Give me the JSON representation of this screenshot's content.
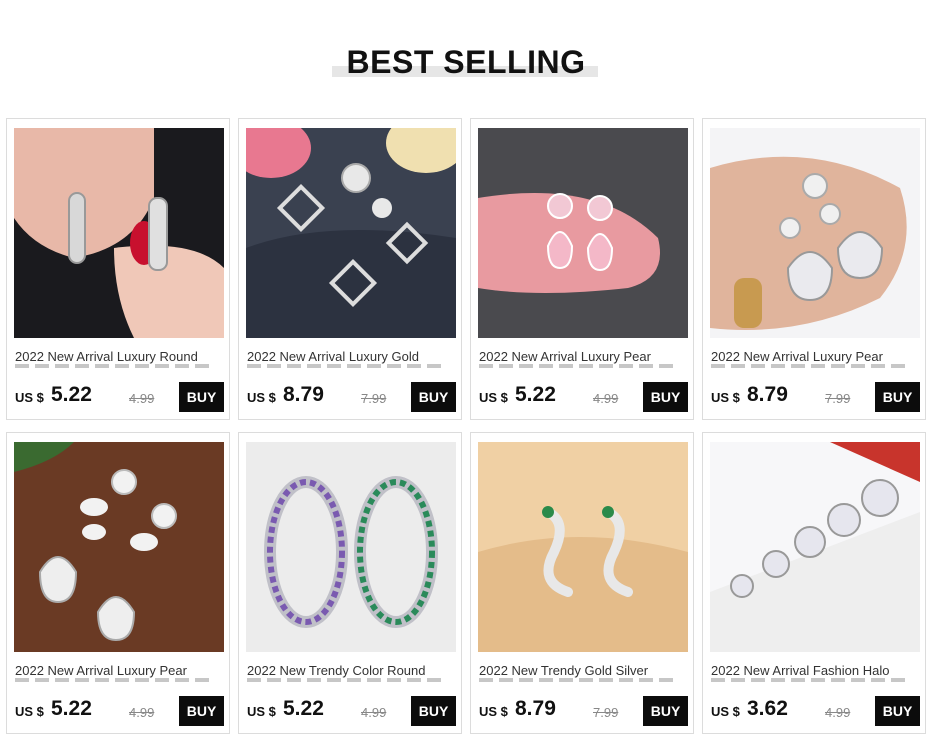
{
  "section": {
    "title": "BEST SELLING"
  },
  "products": [
    {
      "title": "2022 New Arrival Luxury Round",
      "currency": "US $",
      "price": "5.22",
      "old_price": "4.99",
      "buy_label": "BUY",
      "image_icon": "hoop-earring-photo"
    },
    {
      "title": "2022 New Arrival Luxury Gold",
      "currency": "US $",
      "price": "8.79",
      "old_price": "7.99",
      "buy_label": "BUY",
      "image_icon": "square-drop-earring-photo"
    },
    {
      "title": "2022 New Arrival Luxury Pear",
      "currency": "US $",
      "price": "5.22",
      "old_price": "4.99",
      "buy_label": "BUY",
      "image_icon": "pink-pear-earring-photo"
    },
    {
      "title": "2022 New Arrival Luxury Pear",
      "currency": "US $",
      "price": "8.79",
      "old_price": "7.99",
      "buy_label": "BUY",
      "image_icon": "pear-drop-earring-photo"
    },
    {
      "title": "2022 New Arrival Luxury Pear",
      "currency": "US $",
      "price": "5.22",
      "old_price": "4.99",
      "buy_label": "BUY",
      "image_icon": "leaf-drop-earring-photo"
    },
    {
      "title": "2022 New Trendy Color Round",
      "currency": "US $",
      "price": "5.22",
      "old_price": "4.99",
      "buy_label": "BUY",
      "image_icon": "rainbow-hoop-earring-photo"
    },
    {
      "title": "2022 New Trendy Gold Silver",
      "currency": "US $",
      "price": "8.79",
      "old_price": "7.99",
      "buy_label": "BUY",
      "image_icon": "snake-earring-photo"
    },
    {
      "title": "2022 New Arrival Fashion Halo",
      "currency": "US $",
      "price": "3.62",
      "old_price": "4.99",
      "buy_label": "BUY",
      "image_icon": "stud-earrings-set-photo"
    }
  ]
}
